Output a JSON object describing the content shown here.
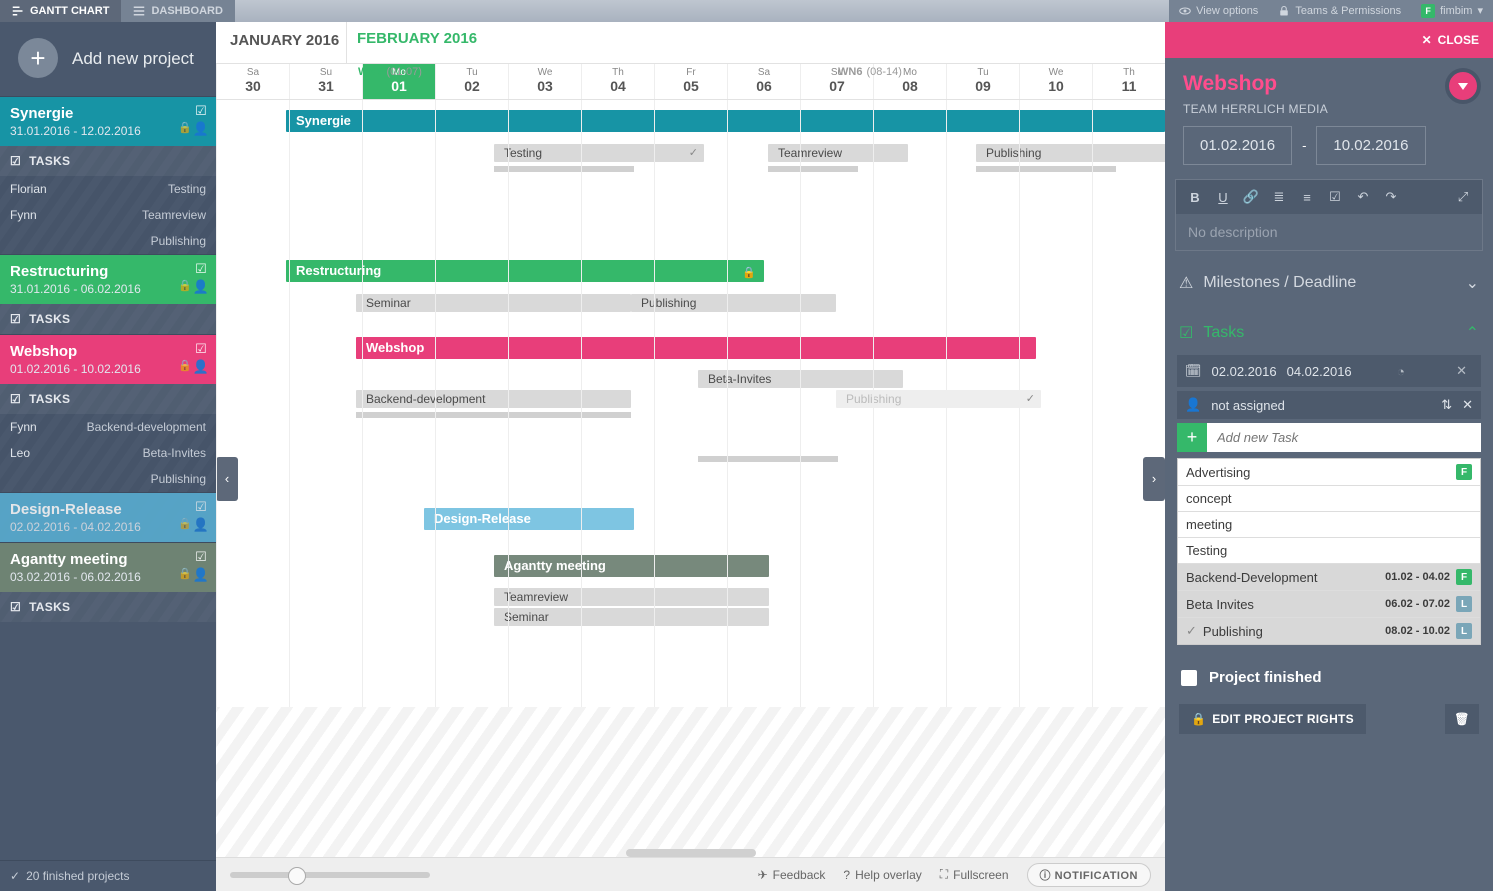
{
  "topbar": {
    "gantt": "GANTT CHART",
    "dashboard": "DASHBOARD",
    "view_options": "View options",
    "teams": "Teams & Permissions",
    "user": "fimbim",
    "user_initial": "F"
  },
  "sidebar": {
    "add_new": "Add new project",
    "finished": "20  finished projects",
    "projects": [
      {
        "key": "synergie",
        "name": "Synergie",
        "dates": "31.01.2016 - 12.02.2016",
        "tasks_hd": "TASKS",
        "people": [
          {
            "name": "Florian",
            "task": "Testing"
          },
          {
            "name": "Fynn",
            "task": "Teamreview"
          },
          {
            "name": "",
            "task": "Publishing"
          }
        ]
      },
      {
        "key": "restruct",
        "name": "Restructuring",
        "dates": "31.01.2016 - 06.02.2016",
        "tasks_hd": "TASKS",
        "people": []
      },
      {
        "key": "webshop",
        "name": "Webshop",
        "dates": "01.02.2016 - 10.02.2016",
        "tasks_hd": "TASKS",
        "people": [
          {
            "name": "Fynn",
            "task": "Backend-development"
          },
          {
            "name": "Leo",
            "task": "Beta-Invites"
          },
          {
            "name": "",
            "task": "Publishing"
          }
        ]
      },
      {
        "key": "design",
        "name": "Design-Release",
        "dates": "02.02.2016 - 04.02.2016",
        "tasks_hd": "",
        "people": []
      },
      {
        "key": "agantty",
        "name": "Agantty meeting",
        "dates": "03.02.2016 - 06.02.2016",
        "tasks_hd": "TASKS",
        "people": []
      }
    ]
  },
  "header": {
    "jan": "JANUARY 2016",
    "feb": "FEBRUARY 2016",
    "wn5": "WN5",
    "wn5_range": "(01-07)",
    "wn6": "WN6",
    "wn6_range": "(08-14)",
    "days": [
      {
        "dw": "Sa",
        "dn": "30"
      },
      {
        "dw": "Su",
        "dn": "31"
      },
      {
        "dw": "Mo",
        "dn": "01",
        "today": true
      },
      {
        "dw": "Tu",
        "dn": "02"
      },
      {
        "dw": "We",
        "dn": "03"
      },
      {
        "dw": "Th",
        "dn": "04"
      },
      {
        "dw": "Fr",
        "dn": "05"
      },
      {
        "dw": "Sa",
        "dn": "06"
      },
      {
        "dw": "Su",
        "dn": "07"
      },
      {
        "dw": "Mo",
        "dn": "08"
      },
      {
        "dw": "Tu",
        "dn": "09"
      },
      {
        "dw": "We",
        "dn": "10"
      },
      {
        "dw": "Th",
        "dn": "11"
      }
    ]
  },
  "bars": {
    "synergie": "Synergie",
    "testing": "Testing",
    "teamreview": "Teamreview",
    "publishing": "Publishing",
    "restructuring": "Restructuring",
    "seminar": "Seminar",
    "publishing2": "Publishing",
    "webshop": "Webshop",
    "beta": "Beta-Invites",
    "backend": "Backend-development",
    "publishing3": "Publishing",
    "design": "Design-Release",
    "agantty": "Agantty meeting",
    "teamreview2": "Teamreview",
    "seminar2": "Seminar"
  },
  "rightpanel": {
    "close": "CLOSE",
    "title": "Webshop",
    "team": "TEAM HERRLICH MEDIA",
    "date_from": "01.02.2016",
    "date_to": "10.02.2016",
    "desc_placeholder": "No description",
    "milestones": "Milestones / Deadline",
    "tasks": "Tasks",
    "task_date_from": "02.02.2016",
    "task_date_to": "04.02.2016",
    "assignee": "not assigned",
    "add_task_placeholder": "Add new Task",
    "tasklist": [
      {
        "name": "Advertising",
        "dates": "",
        "badge": "F",
        "bcol": "green",
        "shade": false
      },
      {
        "name": "concept",
        "dates": "",
        "badge": "",
        "bcol": "",
        "shade": false
      },
      {
        "name": "meeting",
        "dates": "",
        "badge": "",
        "bcol": "",
        "shade": false
      },
      {
        "name": "Testing",
        "dates": "",
        "badge": "",
        "bcol": "",
        "shade": false
      },
      {
        "name": "Backend-Development",
        "dates": "01.02 - 04.02",
        "badge": "F",
        "bcol": "green",
        "shade": true
      },
      {
        "name": "Beta Invites",
        "dates": "06.02 - 07.02",
        "badge": "L",
        "bcol": "blue",
        "shade": true
      },
      {
        "name": "Publishing",
        "dates": "08.02 - 10.02",
        "badge": "L",
        "bcol": "blue",
        "shade": true,
        "done": true
      }
    ],
    "finished": "Project finished",
    "edit_rights": "EDIT PROJECT RIGHTS"
  },
  "footer": {
    "feedback": "Feedback",
    "help": "Help overlay",
    "fullscreen": "Fullscreen",
    "notification": "NOTIFICATION"
  }
}
